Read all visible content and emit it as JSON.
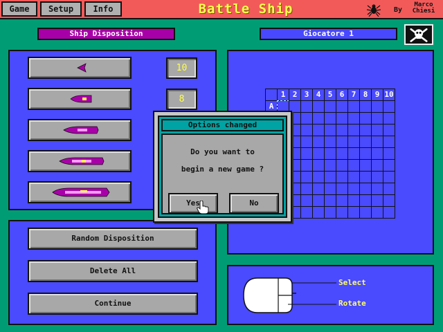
{
  "menu": {
    "game": "Game",
    "setup": "Setup",
    "info": "Info"
  },
  "title": "Battle Ship",
  "by": "By",
  "author": [
    "Marco",
    "Chiesi"
  ],
  "ship_disposition_label": "Ship Disposition",
  "player_label": "Giocatore 1",
  "ships": [
    {
      "name": "ship-1",
      "count": "10"
    },
    {
      "name": "ship-2",
      "count": "8"
    },
    {
      "name": "ship-3",
      "count": ""
    },
    {
      "name": "ship-4",
      "count": ""
    },
    {
      "name": "ship-5",
      "count": ""
    }
  ],
  "actions": {
    "random": "Random Disposition",
    "delete": "Delete All",
    "continue": "Continue"
  },
  "grid": {
    "columns": [
      "1",
      "2",
      "3",
      "4",
      "5",
      "6",
      "7",
      "8",
      "9",
      "10"
    ],
    "rows": [
      "A"
    ]
  },
  "dialog": {
    "title": "Options changed",
    "line1": "Do you want to",
    "line2": "begin a new game ?",
    "yes": "Yes",
    "no": "No"
  },
  "mouse": {
    "select": "Select",
    "rotate": "Rotate"
  },
  "colors": {
    "background": "#009d74",
    "topbar": "#f25a5a",
    "panel": "#4a4aff",
    "title": "#ffff4c",
    "dialog": "#00a3a3"
  }
}
